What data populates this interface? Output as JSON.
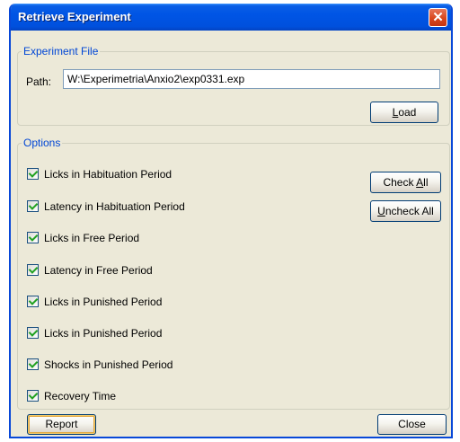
{
  "window": {
    "title": "Retrieve Experiment",
    "close_glyph": "✕"
  },
  "file_group": {
    "legend": "Experiment File",
    "path_label": "Path:",
    "path_value": "W:\\Experimetria\\Anxio2\\exp0331.exp",
    "load_label_first": "L",
    "load_label_rest": "oad"
  },
  "options_group": {
    "legend": "Options",
    "check_all_pre": "Check ",
    "check_all_key": "A",
    "check_all_post": "ll",
    "uncheck_all_key": "U",
    "uncheck_all_post": "ncheck All",
    "items": [
      {
        "label": "Licks in Habituation Period",
        "checked": true
      },
      {
        "label": "Latency in Habituation Period",
        "checked": true
      },
      {
        "label": "Licks in Free Period",
        "checked": true
      },
      {
        "label": "Latency in Free Period",
        "checked": true
      },
      {
        "label": "Licks in Punished Period",
        "checked": true
      },
      {
        "label": "Licks in Punished Period",
        "checked": true
      },
      {
        "label": "Shocks in Punished Period",
        "checked": true
      },
      {
        "label": "Recovery Time",
        "checked": true
      }
    ]
  },
  "footer": {
    "report_label": "Report",
    "close_label": "Close"
  },
  "colors": {
    "title_bar": "#0050dd",
    "group_legend": "#0046d5",
    "close_button": "#d9471c",
    "checkmark": "#21a121"
  }
}
